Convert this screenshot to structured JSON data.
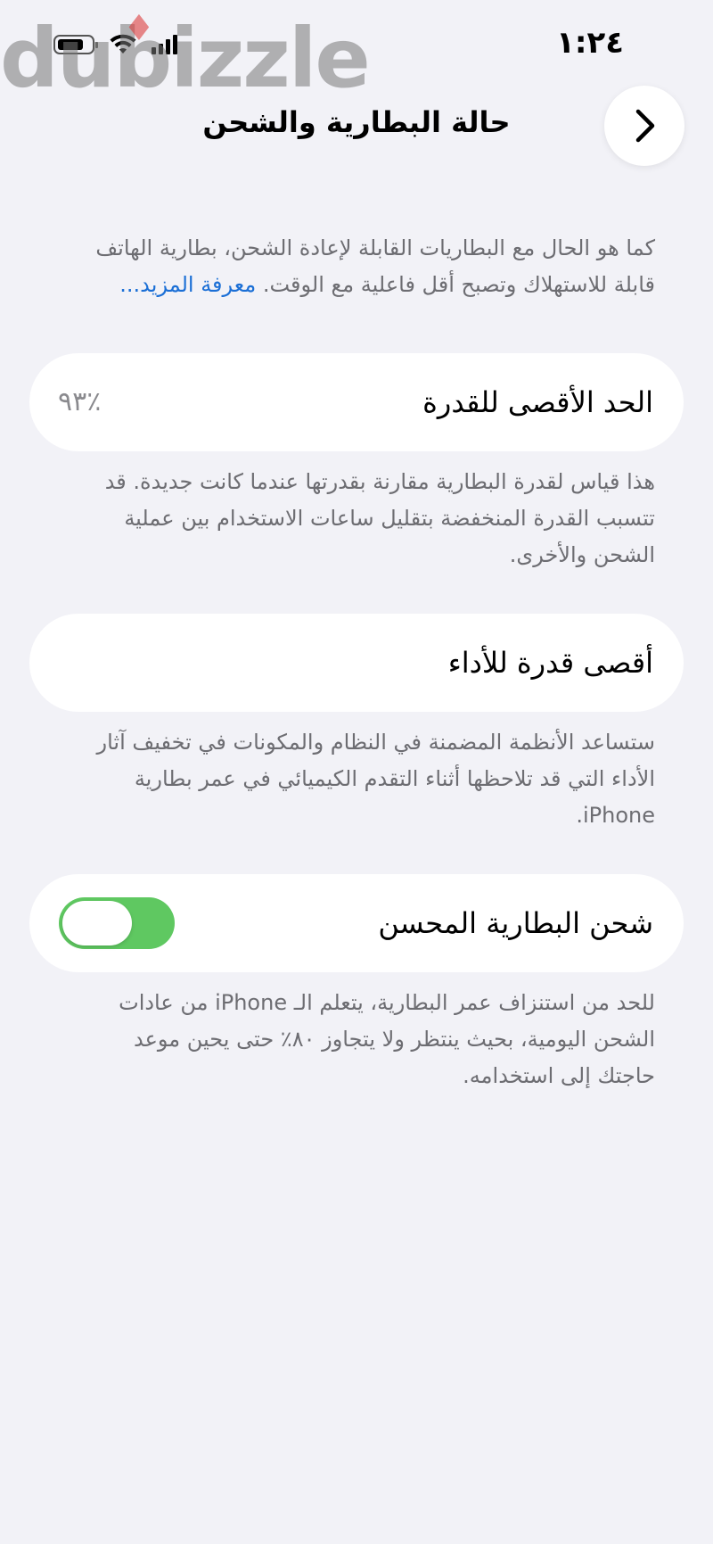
{
  "status_bar": {
    "time": "١:٢٤",
    "icons": [
      "battery-icon",
      "wifi-icon",
      "cellular-signal-icon"
    ]
  },
  "watermark": {
    "text": "dubizzle"
  },
  "nav": {
    "title": "حالة البطارية والشحن",
    "back_icon": "chevron-right-icon"
  },
  "intro": {
    "text": "كما هو الحال مع البطاريات القابلة لإعادة الشحن، بطارية الهاتف قابلة للاستهلاك وتصبح أقل فاعلية مع الوقت. ",
    "link": "معرفة المزيد..."
  },
  "max_capacity": {
    "label": "الحد الأقصى للقدرة",
    "value": "٪٩٣",
    "description": "هذا قياس لقدرة البطارية مقارنة بقدرتها عندما كانت جديدة. قد تتسبب القدرة المنخفضة بتقليل ساعات الاستخدام بين عملية الشحن والأخرى."
  },
  "peak_performance": {
    "label": "أقصى قدرة للأداء",
    "description": "ستساعد الأنظمة المضمنة في النظام والمكونات في تخفيف آثار الأداء التي قد تلاحظها أثناء التقدم الكيميائي في عمر بطارية iPhone."
  },
  "optimized_charging": {
    "label": "شحن البطارية المحسن",
    "enabled": true,
    "accent_color": "#5fc861",
    "description": "للحد من استنزاف عمر البطارية، يتعلم الـ iPhone من عادات الشحن اليومية، بحيث ينتظر ولا يتجاوز ٨٠٪ حتى يحين موعد حاجتك إلى استخدامه."
  },
  "colors": {
    "background": "#f2f2f7",
    "card": "#ffffff",
    "link": "#1b6fd6",
    "secondary_text": "#6d6d72"
  }
}
